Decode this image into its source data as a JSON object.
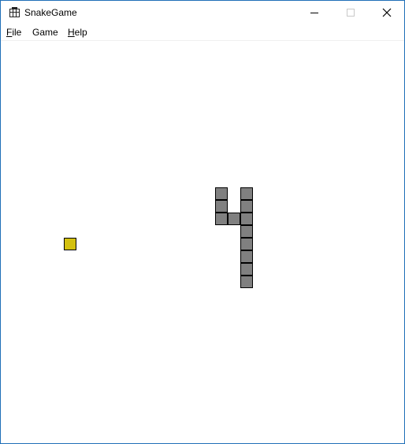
{
  "window": {
    "title": "SnakeGame"
  },
  "menu": {
    "file": {
      "mnemonic": "F",
      "rest": "ile"
    },
    "game": {
      "label": "Game"
    },
    "help": {
      "mnemonic": "H",
      "rest": "elp"
    }
  },
  "game": {
    "grid_unit": "cells",
    "colors": {
      "snake": "#808080",
      "food": "#d4c10f",
      "border": "#000000"
    },
    "snake": [
      [
        19,
        12
      ],
      [
        19,
        13
      ],
      [
        19,
        14
      ],
      [
        19,
        15
      ],
      [
        19,
        16
      ],
      [
        19,
        17
      ],
      [
        19,
        18
      ],
      [
        19,
        19
      ],
      [
        18,
        14
      ],
      [
        17,
        14
      ],
      [
        17,
        13
      ],
      [
        17,
        12
      ]
    ],
    "food": [
      5,
      16
    ]
  }
}
